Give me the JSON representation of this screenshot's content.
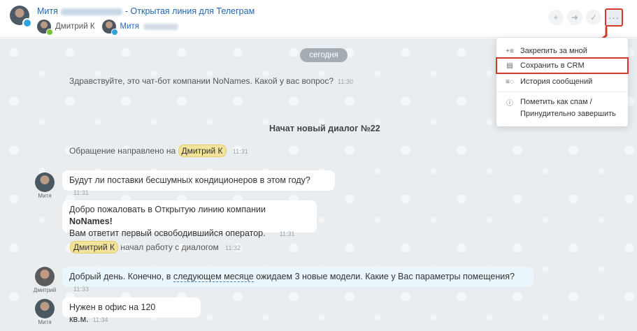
{
  "header": {
    "contact_name": "Митя",
    "title_suffix": "- Открытая линия для Телеграм",
    "participants": [
      {
        "name": "Дмитрий К"
      },
      {
        "name": "Митя"
      }
    ],
    "icons": [
      "plus-icon",
      "forward-icon",
      "check-icon",
      "more-icon"
    ],
    "more_label": "···"
  },
  "menu": {
    "items": [
      {
        "icon": "pin-icon",
        "label": "Закрепить за мной"
      },
      {
        "icon": "crm-icon",
        "label": "Сохранить в CRM"
      },
      {
        "icon": "history-icon",
        "label": "История сообщений"
      },
      {
        "icon": "spam-icon",
        "label": "Пометить как спам /",
        "label2": "Принудительно завершить"
      }
    ]
  },
  "chat": {
    "date": "сегодня",
    "bot_msg": {
      "text": "Здравствуйте, это чат-бот компании NoNames. Какой у вас вопрос?",
      "time": "11:30"
    },
    "new_dialog": "Начат новый диалог №22",
    "routed": {
      "prefix": "Обращение направлено на",
      "tag": "Дмитрий К",
      "time": "11:31"
    },
    "q1": {
      "text": "Будут ли поставки бесшумных кондиционеров в этом году?",
      "time": "11:31",
      "author": "Митя"
    },
    "welcome": {
      "line1_prefix": "Добро пожаловать в Открытую линию компании ",
      "line1_bold": "NoNames!",
      "line2": "Вам ответит первый освободившийся оператор.",
      "time": "11:31"
    },
    "started": {
      "tag": "Дмитрий К",
      "suffix": "начал работу с диалогом",
      "time": "11:32"
    },
    "answer": {
      "prefix": "Добрый день. Конечно, в ",
      "link": "следующем месяце",
      "suffix": " ожидаем 3 новые модели. Какие у Вас параметры помещения?",
      "time": "11:33",
      "author": "Дмитрий"
    },
    "q2": {
      "text": "Нужен в офис на 120 кв.м.",
      "time": "11:34",
      "author": "Митя"
    }
  },
  "colors": {
    "accent": "#2067b0",
    "highlight": "#d23b2c",
    "tag": "#f4e39a"
  }
}
